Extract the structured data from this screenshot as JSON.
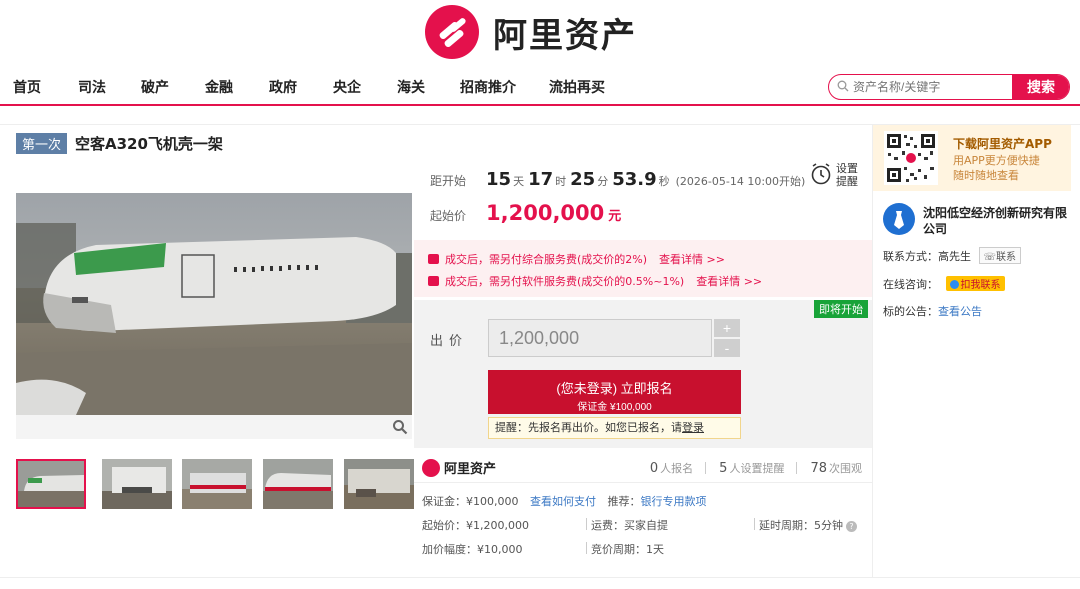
{
  "brand": {
    "name": "阿里资产",
    "color": "#e4114c"
  },
  "nav": {
    "items": [
      "首页",
      "司法",
      "破产",
      "金融",
      "政府",
      "央企",
      "海关",
      "招商推介",
      "流拍再买"
    ]
  },
  "search": {
    "placeholder": "资产名称/关键字",
    "button": "搜索"
  },
  "item": {
    "round_badge": "第一次",
    "title": "空客A320飞机壳一架"
  },
  "countdown": {
    "label": "距开始",
    "days": "15",
    "days_unit": "天",
    "hours": "17",
    "hours_unit": "时",
    "minutes": "25",
    "minutes_unit": "分",
    "seconds": "53.9",
    "seconds_unit": "秒",
    "note": "(2026-05-14 10:00开始)"
  },
  "remind": {
    "label_line1": "设置",
    "label_line2": "提醒"
  },
  "start_price": {
    "label": "起始价",
    "value": "1,200,000",
    "unit": "元"
  },
  "fees": [
    {
      "text": "成交后，需另付综合服务费(成交价的2%)",
      "link": "查看详情 >>"
    },
    {
      "text": "成交后，需另付软件服务费(成交价的0.5%~1%)",
      "link": "查看详情 >>"
    }
  ],
  "bid": {
    "status_tag": "即将开始",
    "label": "出价",
    "value": "1,200,000",
    "plus": "+",
    "minus": "-",
    "signup_line1": "(您未登录) 立即报名",
    "signup_line2": "保证金 ¥100,000",
    "tip_text": "提醒：先报名再出价。如您已报名，请",
    "tip_link": "登录"
  },
  "stats": {
    "brand_text": "阿里资产",
    "signups": "0",
    "signups_label": "人报名",
    "reminders": "5",
    "reminders_label": "人设置提醒",
    "views": "78",
    "views_label": "次围观"
  },
  "details": {
    "deposit": "保证金：¥100,000",
    "deposit_link": "查看如何支付",
    "recommend_label": "推荐：",
    "recommend_link": "银行专用款项",
    "start_price": "起始价：¥1,200,000",
    "shipping": "运费：买家自提",
    "delay": "延时周期：5分钟",
    "increment": "加价幅度：¥10,000",
    "cycle": "竞价周期：1天"
  },
  "sidebar": {
    "app_title": "下载阿里资产APP",
    "app_line1": "用APP更方便快捷",
    "app_line2": "随时随地查看",
    "org_name": "沈阳低空经济创新研究有限公司",
    "contact_label": "联系方式：",
    "contact_name": "高先生",
    "contact_button": "联系",
    "consult_label": "在线咨询：",
    "consult_button": "扣我联系",
    "notice_label": "标的公告：",
    "notice_link": "查看公告"
  }
}
